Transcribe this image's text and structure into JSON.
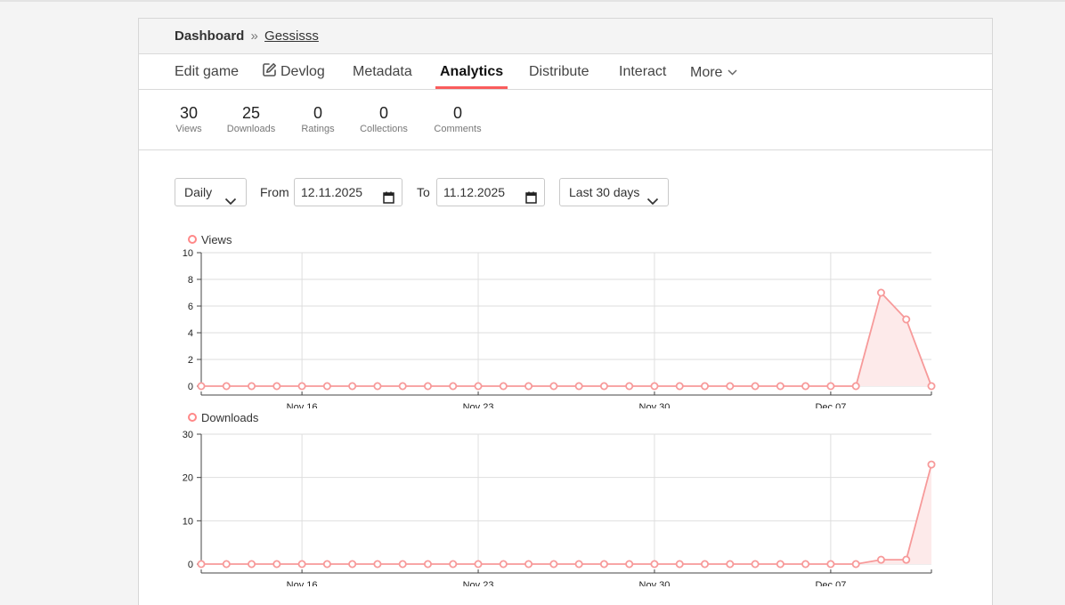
{
  "breadcrumb": {
    "home": "Dashboard",
    "separator": "»",
    "game": "Gessisss"
  },
  "tabs": [
    {
      "label": "Edit game"
    },
    {
      "label": "Devlog",
      "icon": "edit-icon"
    },
    {
      "label": "Metadata"
    },
    {
      "label": "Analytics",
      "active": true
    },
    {
      "label": "Distribute"
    },
    {
      "label": "Interact"
    },
    {
      "label": "More",
      "icon": "chevron-down-icon"
    }
  ],
  "stats": [
    {
      "value": "30",
      "label": "Views"
    },
    {
      "value": "25",
      "label": "Downloads"
    },
    {
      "value": "0",
      "label": "Ratings"
    },
    {
      "value": "0",
      "label": "Collections"
    },
    {
      "value": "0",
      "label": "Comments"
    }
  ],
  "controls": {
    "interval": "Daily",
    "from_label": "From",
    "from_value": "12.11.2025",
    "to_label": "To",
    "to_value": "11.12.2025",
    "range": "Last 30 days"
  },
  "colors": {
    "accent": "#fa5c5c",
    "series": "#f79a9a",
    "series_fill": "#fdeaea"
  },
  "chart_data": [
    {
      "type": "area",
      "legend": "Views",
      "x_tick_labels": [
        "Nov 16",
        "Nov 23",
        "Nov 30",
        "Dec 07"
      ],
      "x_tick_dates": [
        "2025-11-16",
        "2025-11-23",
        "2025-11-30",
        "2025-12-07"
      ],
      "x_start": "2025-11-12",
      "x_end": "2025-12-11",
      "ylim": [
        0,
        10
      ],
      "yticks": [
        0,
        2,
        4,
        6,
        8,
        10
      ],
      "series": [
        {
          "name": "Views",
          "values": [
            0,
            0,
            0,
            0,
            0,
            0,
            0,
            0,
            0,
            0,
            0,
            0,
            0,
            0,
            0,
            0,
            0,
            0,
            0,
            0,
            0,
            0,
            0,
            0,
            0,
            0,
            0,
            7,
            5,
            0
          ]
        }
      ],
      "grid": true,
      "legend_position": "top-left"
    },
    {
      "type": "area",
      "legend": "Downloads",
      "x_tick_labels": [
        "Nov 16",
        "Nov 23",
        "Nov 30",
        "Dec 07"
      ],
      "x_tick_dates": [
        "2025-11-16",
        "2025-11-23",
        "2025-11-30",
        "2025-12-07"
      ],
      "x_start": "2025-11-12",
      "x_end": "2025-12-11",
      "ylim": [
        0,
        30
      ],
      "yticks": [
        0,
        10,
        20,
        30
      ],
      "series": [
        {
          "name": "Downloads",
          "values": [
            0,
            0,
            0,
            0,
            0,
            0,
            0,
            0,
            0,
            0,
            0,
            0,
            0,
            0,
            0,
            0,
            0,
            0,
            0,
            0,
            0,
            0,
            0,
            0,
            0,
            0,
            0,
            1,
            1,
            23
          ]
        }
      ],
      "grid": true,
      "legend_position": "top-left"
    }
  ]
}
